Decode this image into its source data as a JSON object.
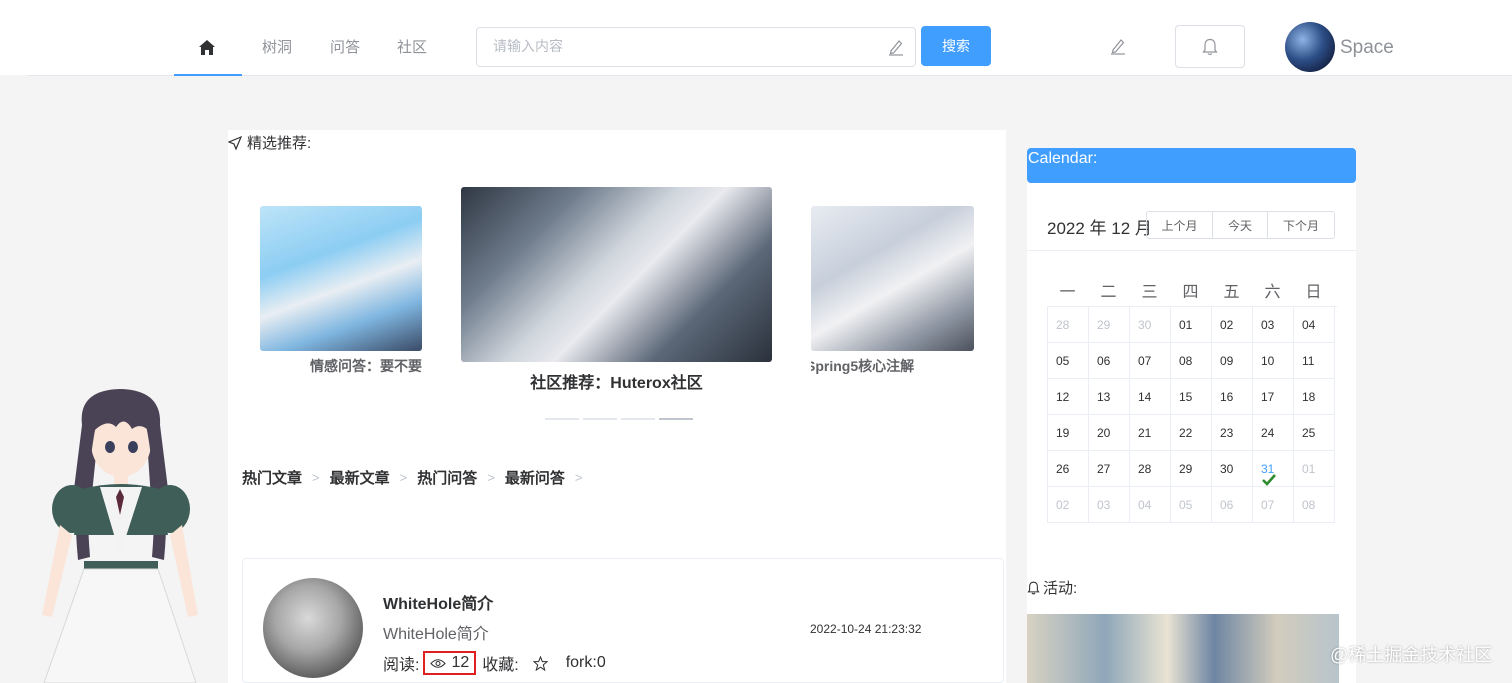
{
  "header": {
    "nav": [
      {
        "label": "树洞"
      },
      {
        "label": "问答"
      },
      {
        "label": "社区"
      }
    ],
    "search_placeholder": "请输入内容",
    "search_button": "搜索",
    "user_name": "Space",
    "home_icon": "home-icon",
    "edit_icon": "edit-icon",
    "bell_icon": "bell-icon"
  },
  "featured": {
    "title": "精选推荐:",
    "captions": [
      "情感问答：要不要",
      "社区推荐：Huterox社区",
      "Spring5核心注解"
    ],
    "breadcrumbs": [
      "热门文章",
      "最新文章",
      "热门问答",
      "最新问答"
    ]
  },
  "article": {
    "title": "WhiteHole简介",
    "desc": "WhiteHole简介",
    "date": "2022-10-24 21:23:32",
    "read_label": "阅读:",
    "read_count": "12",
    "fav_label": "收藏:",
    "fork_label": "fork:0"
  },
  "calendar": {
    "title": "Calendar:",
    "month": "2022 年 12 月",
    "buttons": [
      "上个月",
      "今天",
      "下个月"
    ],
    "weekdays": [
      "一",
      "二",
      "三",
      "四",
      "五",
      "六",
      "日"
    ],
    "days": [
      [
        "28",
        "29",
        "30",
        "01",
        "02",
        "03",
        "04"
      ],
      [
        "05",
        "06",
        "07",
        "08",
        "09",
        "10",
        "11"
      ],
      [
        "12",
        "13",
        "14",
        "15",
        "16",
        "17",
        "18"
      ],
      [
        "19",
        "20",
        "21",
        "22",
        "23",
        "24",
        "25"
      ],
      [
        "26",
        "27",
        "28",
        "29",
        "30",
        "31",
        "01"
      ],
      [
        "02",
        "03",
        "04",
        "05",
        "06",
        "07",
        "08"
      ]
    ]
  },
  "activity": {
    "title": "活动:"
  },
  "watermark": "@稀土掘金技术社区",
  "colors": {
    "primary": "#409eff",
    "highlight_box": "#e02020"
  }
}
